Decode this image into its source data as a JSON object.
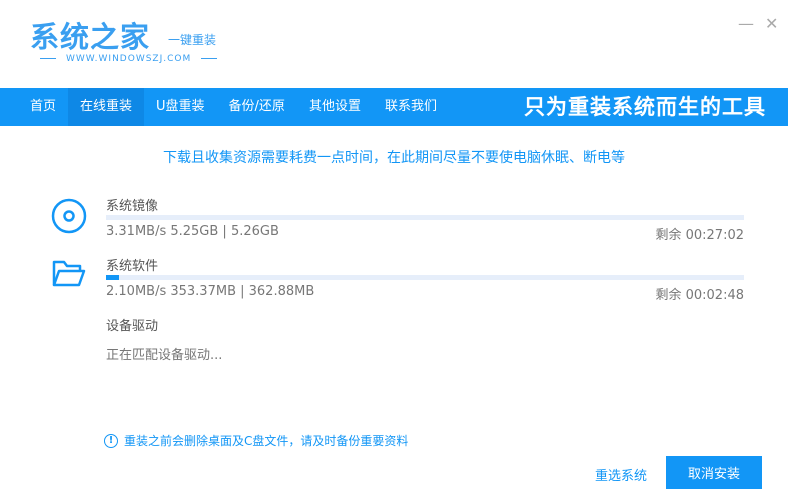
{
  "logo": {
    "name": "系统之家",
    "tagline": "一键重装",
    "url": "WWW.WINDOWSZJ.COM"
  },
  "window": {
    "minimize": "—",
    "close": "✕"
  },
  "nav": {
    "items": [
      "首页",
      "在线重装",
      "U盘重装",
      "备份/还原",
      "其他设置",
      "联系我们"
    ],
    "active": 1,
    "slogan": "只为重装系统而生的工具"
  },
  "notice": "下载且收集资源需要耗费一点时间，在此期间尽量不要使电脑休眠、断电等",
  "tasks": [
    {
      "title": "系统镜像",
      "stats": "3.31MB/s 5.25GB | 5.26GB",
      "remain": "剩余 00:27:02",
      "progress": 0
    },
    {
      "title": "系统软件",
      "stats": "2.10MB/s 353.37MB | 362.88MB",
      "remain": "剩余 00:02:48",
      "progress": 2
    },
    {
      "title": "设备驱动",
      "status": "正在匹配设备驱动..."
    }
  ],
  "warning": {
    "icon": "!",
    "text": "重装之前会删除桌面及C盘文件，请及时备份重要资料"
  },
  "buttons": {
    "reselect": "重选系统",
    "cancel": "取消安装"
  },
  "colors": {
    "accent": "#1296f6"
  }
}
